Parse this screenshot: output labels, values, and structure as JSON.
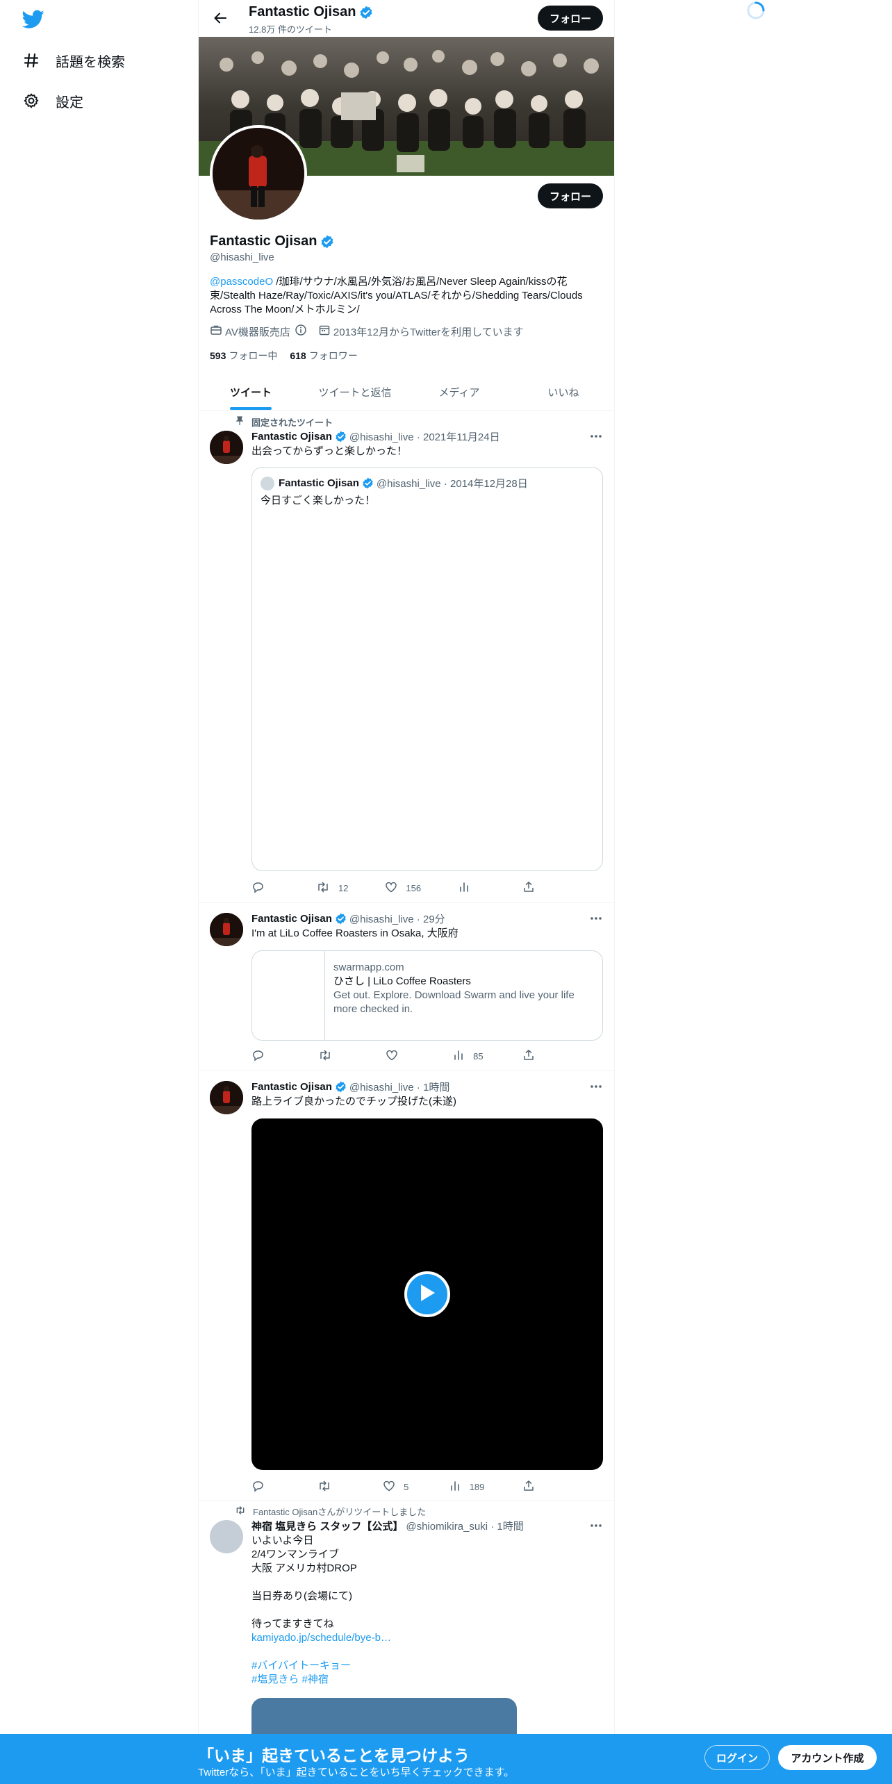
{
  "sidebar": {
    "items": [
      {
        "label": "話題を検索",
        "icon": "hashtag-icon"
      },
      {
        "label": "設定",
        "icon": "gear-icon"
      }
    ]
  },
  "header": {
    "name": "Fantastic Ojisan",
    "tweet_count": "12.8万 件のツイート",
    "follow_label": "フォロー"
  },
  "profile": {
    "name": "Fantastic Ojisan",
    "handle": "@hisashi_live",
    "follow_label": "フォロー",
    "bio_mention": "@passcodeO",
    "bio_text": " /珈琲/サウナ/水風呂/外気浴/お風呂/Never Sleep Again/kissの花束/Stealth Haze/Ray/Toxic/AXIS/it's you/ATLAS/それから/Shedding Tears/Clouds Across The Moon/メトホルミン/",
    "category": "AV機器販売店",
    "joined": "2013年12月からTwitterを利用しています",
    "following_count": "593",
    "following_label": "フォロー中",
    "followers_count": "618",
    "followers_label": "フォロワー"
  },
  "tabs": [
    {
      "label": "ツイート",
      "active": true
    },
    {
      "label": "ツイートと返信",
      "active": false
    },
    {
      "label": "メディア",
      "active": false
    },
    {
      "label": "いいね",
      "active": false
    }
  ],
  "tweets": [
    {
      "context": "固定されたツイート",
      "name": "Fantastic Ojisan",
      "meta": "@hisashi_live · 2021年11月24日",
      "text": "出会ってからずっと楽しかった！",
      "quote": {
        "name": "Fantastic Ojisan",
        "meta": "@hisashi_live · 2014年12月28日",
        "text": "今日すごく楽しかった！"
      },
      "retweets": "12",
      "likes": "156",
      "views": ""
    },
    {
      "name": "Fantastic Ojisan",
      "meta": "@hisashi_live · 29分",
      "text": "I'm at LiLo Coffee Roasters in Osaka, 大阪府",
      "card": {
        "domain": "swarmapp.com",
        "title": "ひさし | LiLo Coffee Roasters",
        "description": "Get out. Explore. Download Swarm and live your life more checked in."
      },
      "views": "85"
    },
    {
      "name": "Fantastic Ojisan",
      "meta": "@hisashi_live · 1時間",
      "text": "路上ライブ良かったのでチップ投げた(未遂)",
      "likes": "5",
      "views": "189"
    },
    {
      "context": "Fantastic Ojisanさんがリツイートしました",
      "name": "神宿 塩見きら スタッフ【公式】",
      "meta": "@shiomikira_suki · 1時間",
      "text": "いよいよ今日\n2/4ワンマンライブ\n大阪 アメリカ村DROP\n\n当日券あり(会場にて)\n\n待ってますきてね",
      "link": "kamiyado.jp/schedule/bye-b…",
      "hashtag1": "#バイバイトーキョー",
      "hashtag2": "#塩見きら #神宿"
    }
  ],
  "bottom_bar": {
    "title": "「いま」起きていることを見つけよう",
    "subtitle": "Twitterなら、「いま」起きていることをいち早くチェックできます。",
    "login": "ログイン",
    "signup": "アカウント作成"
  },
  "colors": {
    "accent": "#1d9bf0",
    "text": "#0f1419",
    "secondary": "#536471"
  }
}
